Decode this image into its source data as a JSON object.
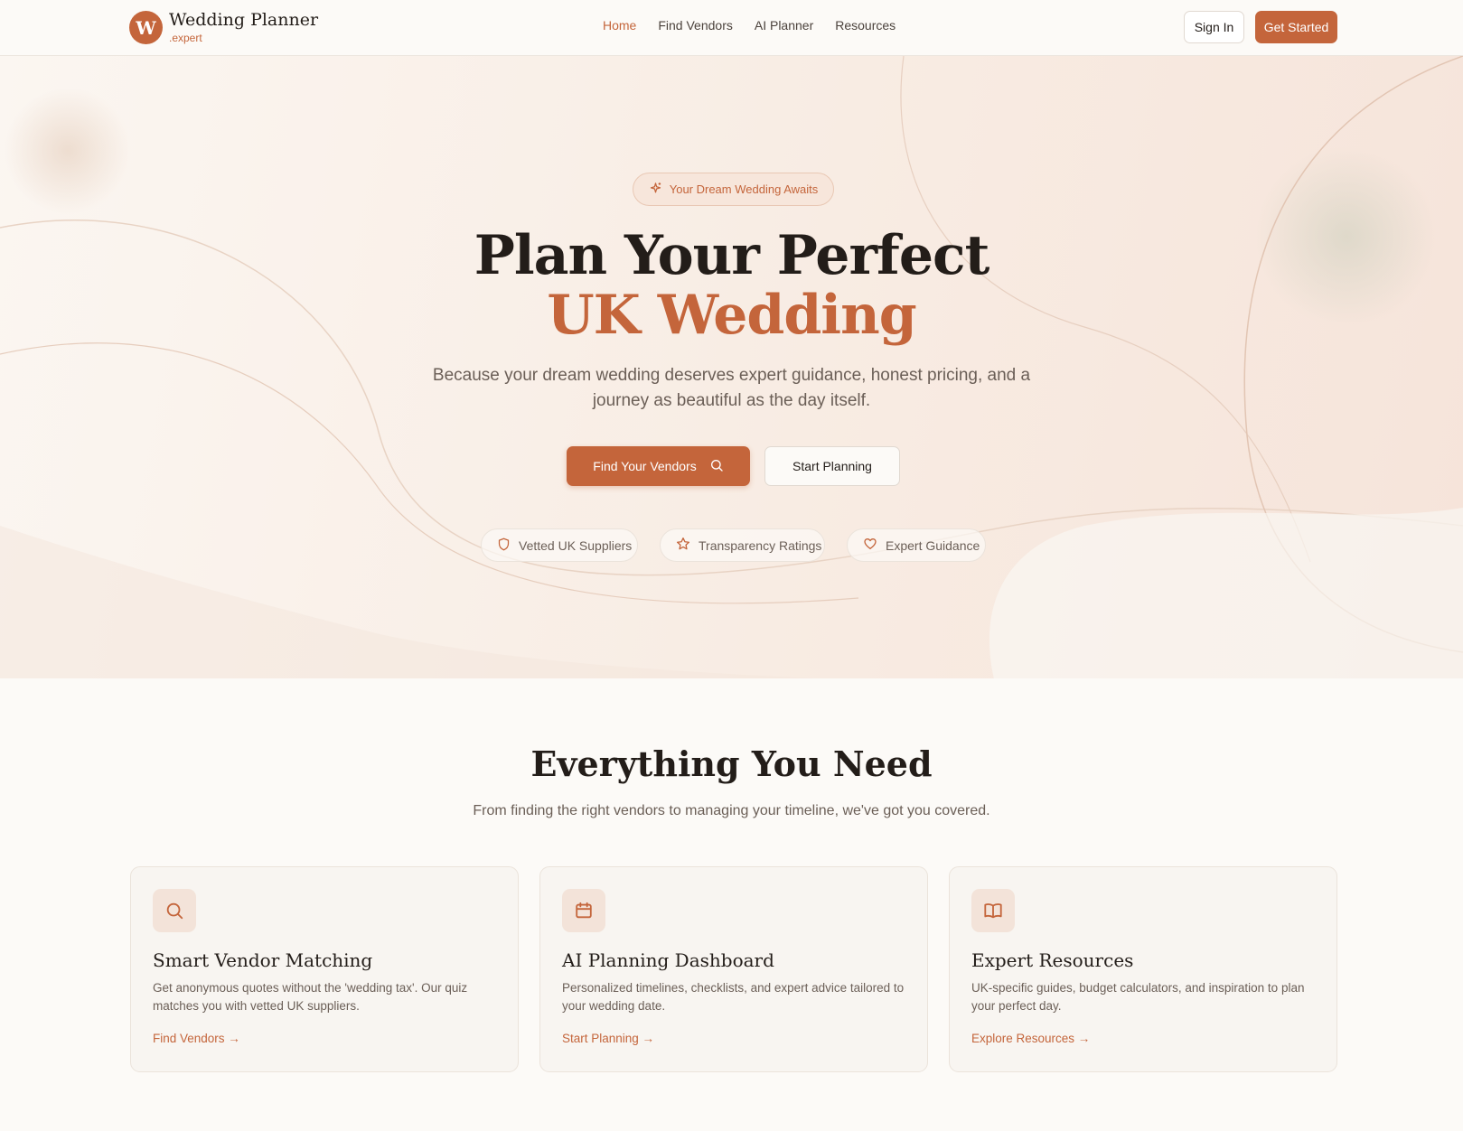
{
  "brand": {
    "initial": "W",
    "title": "Wedding Planner",
    "subtitle": ".expert"
  },
  "nav": {
    "links": [
      "Home",
      "Find Vendors",
      "AI Planner",
      "Resources"
    ],
    "active": "Home",
    "sign_in": "Sign In",
    "get_started": "Get Started"
  },
  "hero": {
    "pill": "Your Dream Wedding Awaits",
    "title_line1": "Plan Your Perfect",
    "title_line2": "UK Wedding",
    "description": "Because your dream wedding deserves expert guidance, honest pricing, and a journey as beautiful as the day itself.",
    "primary_button": "Find Your Vendors",
    "secondary_button": "Start Planning",
    "badges": [
      {
        "label": "Vetted UK Suppliers",
        "icon": "shield-icon"
      },
      {
        "label": "Transparency Ratings",
        "icon": "star-icon"
      },
      {
        "label": "Expert Guidance",
        "icon": "heart-icon"
      }
    ]
  },
  "features": {
    "title": "Everything You Need",
    "subtitle": "From finding the right vendors to managing your timeline, we've got you covered.",
    "cards": [
      {
        "icon": "search-icon",
        "title": "Smart Vendor Matching",
        "description": "Get anonymous quotes without the 'wedding tax'. Our quiz matches you with vetted UK suppliers.",
        "link": "Find Vendors →"
      },
      {
        "icon": "calendar-icon",
        "title": "AI Planning Dashboard",
        "description": "Personalized timelines, checklists, and expert advice tailored to your wedding date.",
        "link": "Start Planning →"
      },
      {
        "icon": "book-icon",
        "title": "Expert Resources",
        "description": "UK-specific guides, budget calculators, and inspiration to plan your perfect day.",
        "link": "Explore Resources →"
      }
    ]
  },
  "colors": {
    "accent": "#c4653b",
    "text": "#231d19",
    "muted": "#6b5f57",
    "background": "#fcfaf7"
  }
}
